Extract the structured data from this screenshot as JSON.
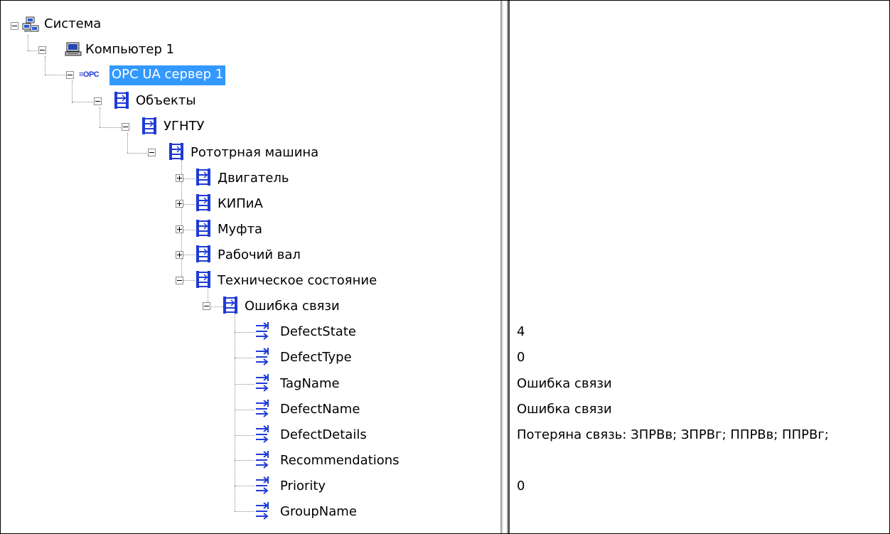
{
  "tree": {
    "system": "Система",
    "computer": "Компьютер 1",
    "server": "OPC UA сервер 1",
    "server_icon_text": "≡OPC",
    "objects": "Объекты",
    "ugntu": "УГНТУ",
    "machine": "Рототрная машина",
    "engine": "Двигатель",
    "kipia": "КИПиА",
    "coupling": "Муфта",
    "shaft": "Рабочий вал",
    "tech_state": "Техническое состояние",
    "comm_error": "Ошибка связи",
    "tags": [
      {
        "name": "DefectState",
        "value": "4"
      },
      {
        "name": "DefectType",
        "value": "0"
      },
      {
        "name": "TagName",
        "value": "Ошибка связи"
      },
      {
        "name": "DefectName",
        "value": "Ошибка связи"
      },
      {
        "name": "DefectDetails",
        "value": "Потеряна связь: ЗПРВв; ЗПРВг; ППРВв; ППРВг;"
      },
      {
        "name": "Recommendations",
        "value": ""
      },
      {
        "name": "Priority",
        "value": "0"
      },
      {
        "name": "GroupName",
        "value": ""
      }
    ]
  },
  "icons": {
    "system": "network-computers-icon",
    "computer": "computer-icon",
    "server": "opc-server-icon",
    "folder": "object-folder-icon",
    "tag": "tag-variable-icon"
  },
  "colors": {
    "selection": "#3399ff",
    "icon_blue": "#1f3bd6"
  }
}
